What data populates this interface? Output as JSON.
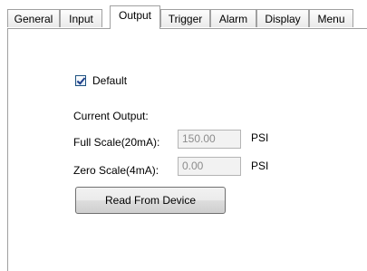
{
  "tabs": [
    {
      "label": "General"
    },
    {
      "label": "Input"
    },
    {
      "label": "Output",
      "active": true
    },
    {
      "label": "Trigger"
    },
    {
      "label": "Alarm"
    },
    {
      "label": "Display"
    },
    {
      "label": "Menu"
    }
  ],
  "output": {
    "default_label": "Default",
    "default_checked": true,
    "current_output_label": "Current Output:",
    "full_scale": {
      "label": "Full Scale(20mA):",
      "value": "150.00",
      "unit": "PSI"
    },
    "zero_scale": {
      "label": "Zero Scale(4mA):",
      "value": "0.00",
      "unit": "PSI"
    },
    "read_button_label": "Read From Device"
  }
}
